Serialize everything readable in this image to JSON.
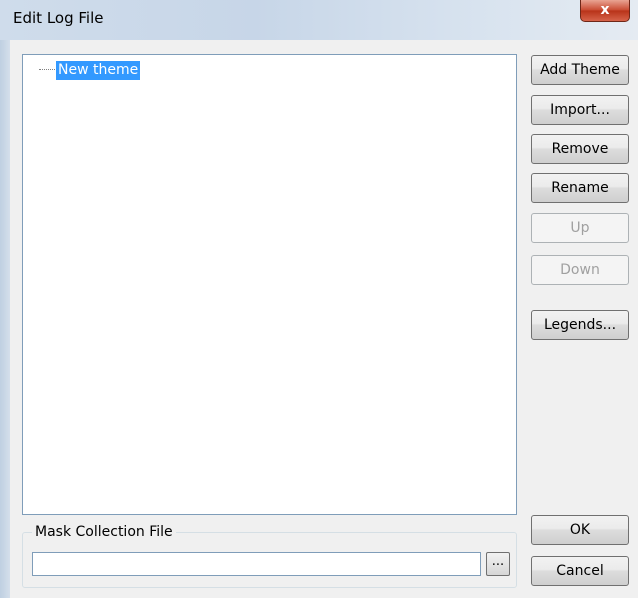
{
  "window": {
    "title": "Edit Log File",
    "close_glyph": "x"
  },
  "tree": {
    "items": [
      {
        "label": "New theme",
        "selected": true
      }
    ]
  },
  "buttons": {
    "add_theme": "Add Theme",
    "import": "Import...",
    "remove": "Remove",
    "rename": "Rename",
    "up": "Up",
    "down": "Down",
    "legends": "Legends...",
    "ok": "OK",
    "cancel": "Cancel"
  },
  "mask": {
    "group_label": "Mask Collection File",
    "value": "",
    "browse_label": "..."
  },
  "colors": {
    "selection": "#3399ff",
    "close_button": "#c8482f"
  }
}
